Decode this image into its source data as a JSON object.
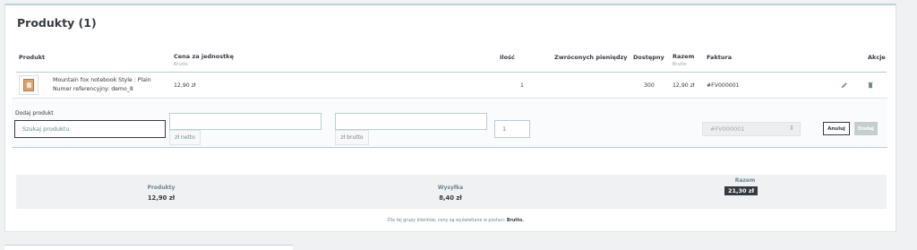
{
  "title": "Produkty (1)",
  "columns": {
    "produkt": "Produkt",
    "cena": "Cena za jednostkę",
    "cena_sub": "Brutto",
    "ilosc": "Ilość",
    "zwroconych": "Zwróconych pieniędzy",
    "dostepny": "Dostępny",
    "razem": "Razem",
    "razem_sub": "Brutto",
    "faktura": "Faktura",
    "akcje": "Akcje"
  },
  "row": {
    "name": "Mountain fox notebook Style : Plain",
    "ref": "Numer referencyjny: demo_8",
    "price": "12,90 zł",
    "qty": "1",
    "available": "300",
    "total": "12,90 zł",
    "invoice": "#FV000001",
    "edit_icon": "pencil-icon",
    "delete_icon": "trash-icon"
  },
  "add": {
    "label": "Dodaj produkt",
    "search_placeholder": "Szukaj produktu",
    "net_addon": "zł netto",
    "gross_addon": "zł brutto",
    "qty_value": "1",
    "invoice_select": "#FV000001",
    "cancel": "Anuluj",
    "add": "Dodaj"
  },
  "summary": {
    "products_label": "Produkty",
    "products_value": "12,90 zł",
    "shipping_label": "Wysyłka",
    "shipping_value": "8,40 zł",
    "total_label": "Razem",
    "total_value": "21,30 zł"
  },
  "note_prefix": "Dla tej grupy klientów, ceny są wyświetlane w postaci:",
  "note_bold": "Brutto."
}
